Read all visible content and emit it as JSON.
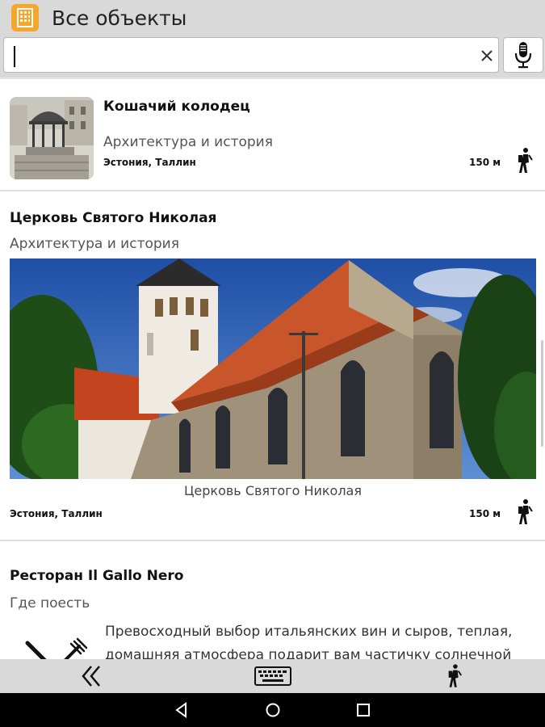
{
  "app": {
    "title": "Все объекты"
  },
  "search": {
    "value": "",
    "placeholder": ""
  },
  "items": [
    {
      "title": "Кошачий колодец",
      "category": "Архитектура и история",
      "location": "Эстония, Таллин",
      "distance": "150 м"
    },
    {
      "title": "Церковь Святого Николая",
      "category": "Архитектура и история",
      "caption": "Церковь Святого Николая",
      "location": "Эстония, Таллин",
      "distance": "150 м"
    },
    {
      "title": "Ресторан Il Gallo Nero",
      "category": "Где поесть",
      "description": "Превосходный выбор итальянских вин и сыров, теплая, домашняя атмосфера подарит вам частичку солнечной"
    }
  ],
  "icons": {
    "app": "building-icon",
    "clear": "close-icon",
    "mic": "microphone-icon",
    "walk": "walking-person-icon",
    "food": "fork-knife-icon",
    "back": "double-chevron-left-icon",
    "keyboard": "keyboard-icon",
    "nav_walk": "walking-person-icon"
  },
  "colors": {
    "accent": "#f4a72c",
    "bar": "#d9d9d9"
  }
}
